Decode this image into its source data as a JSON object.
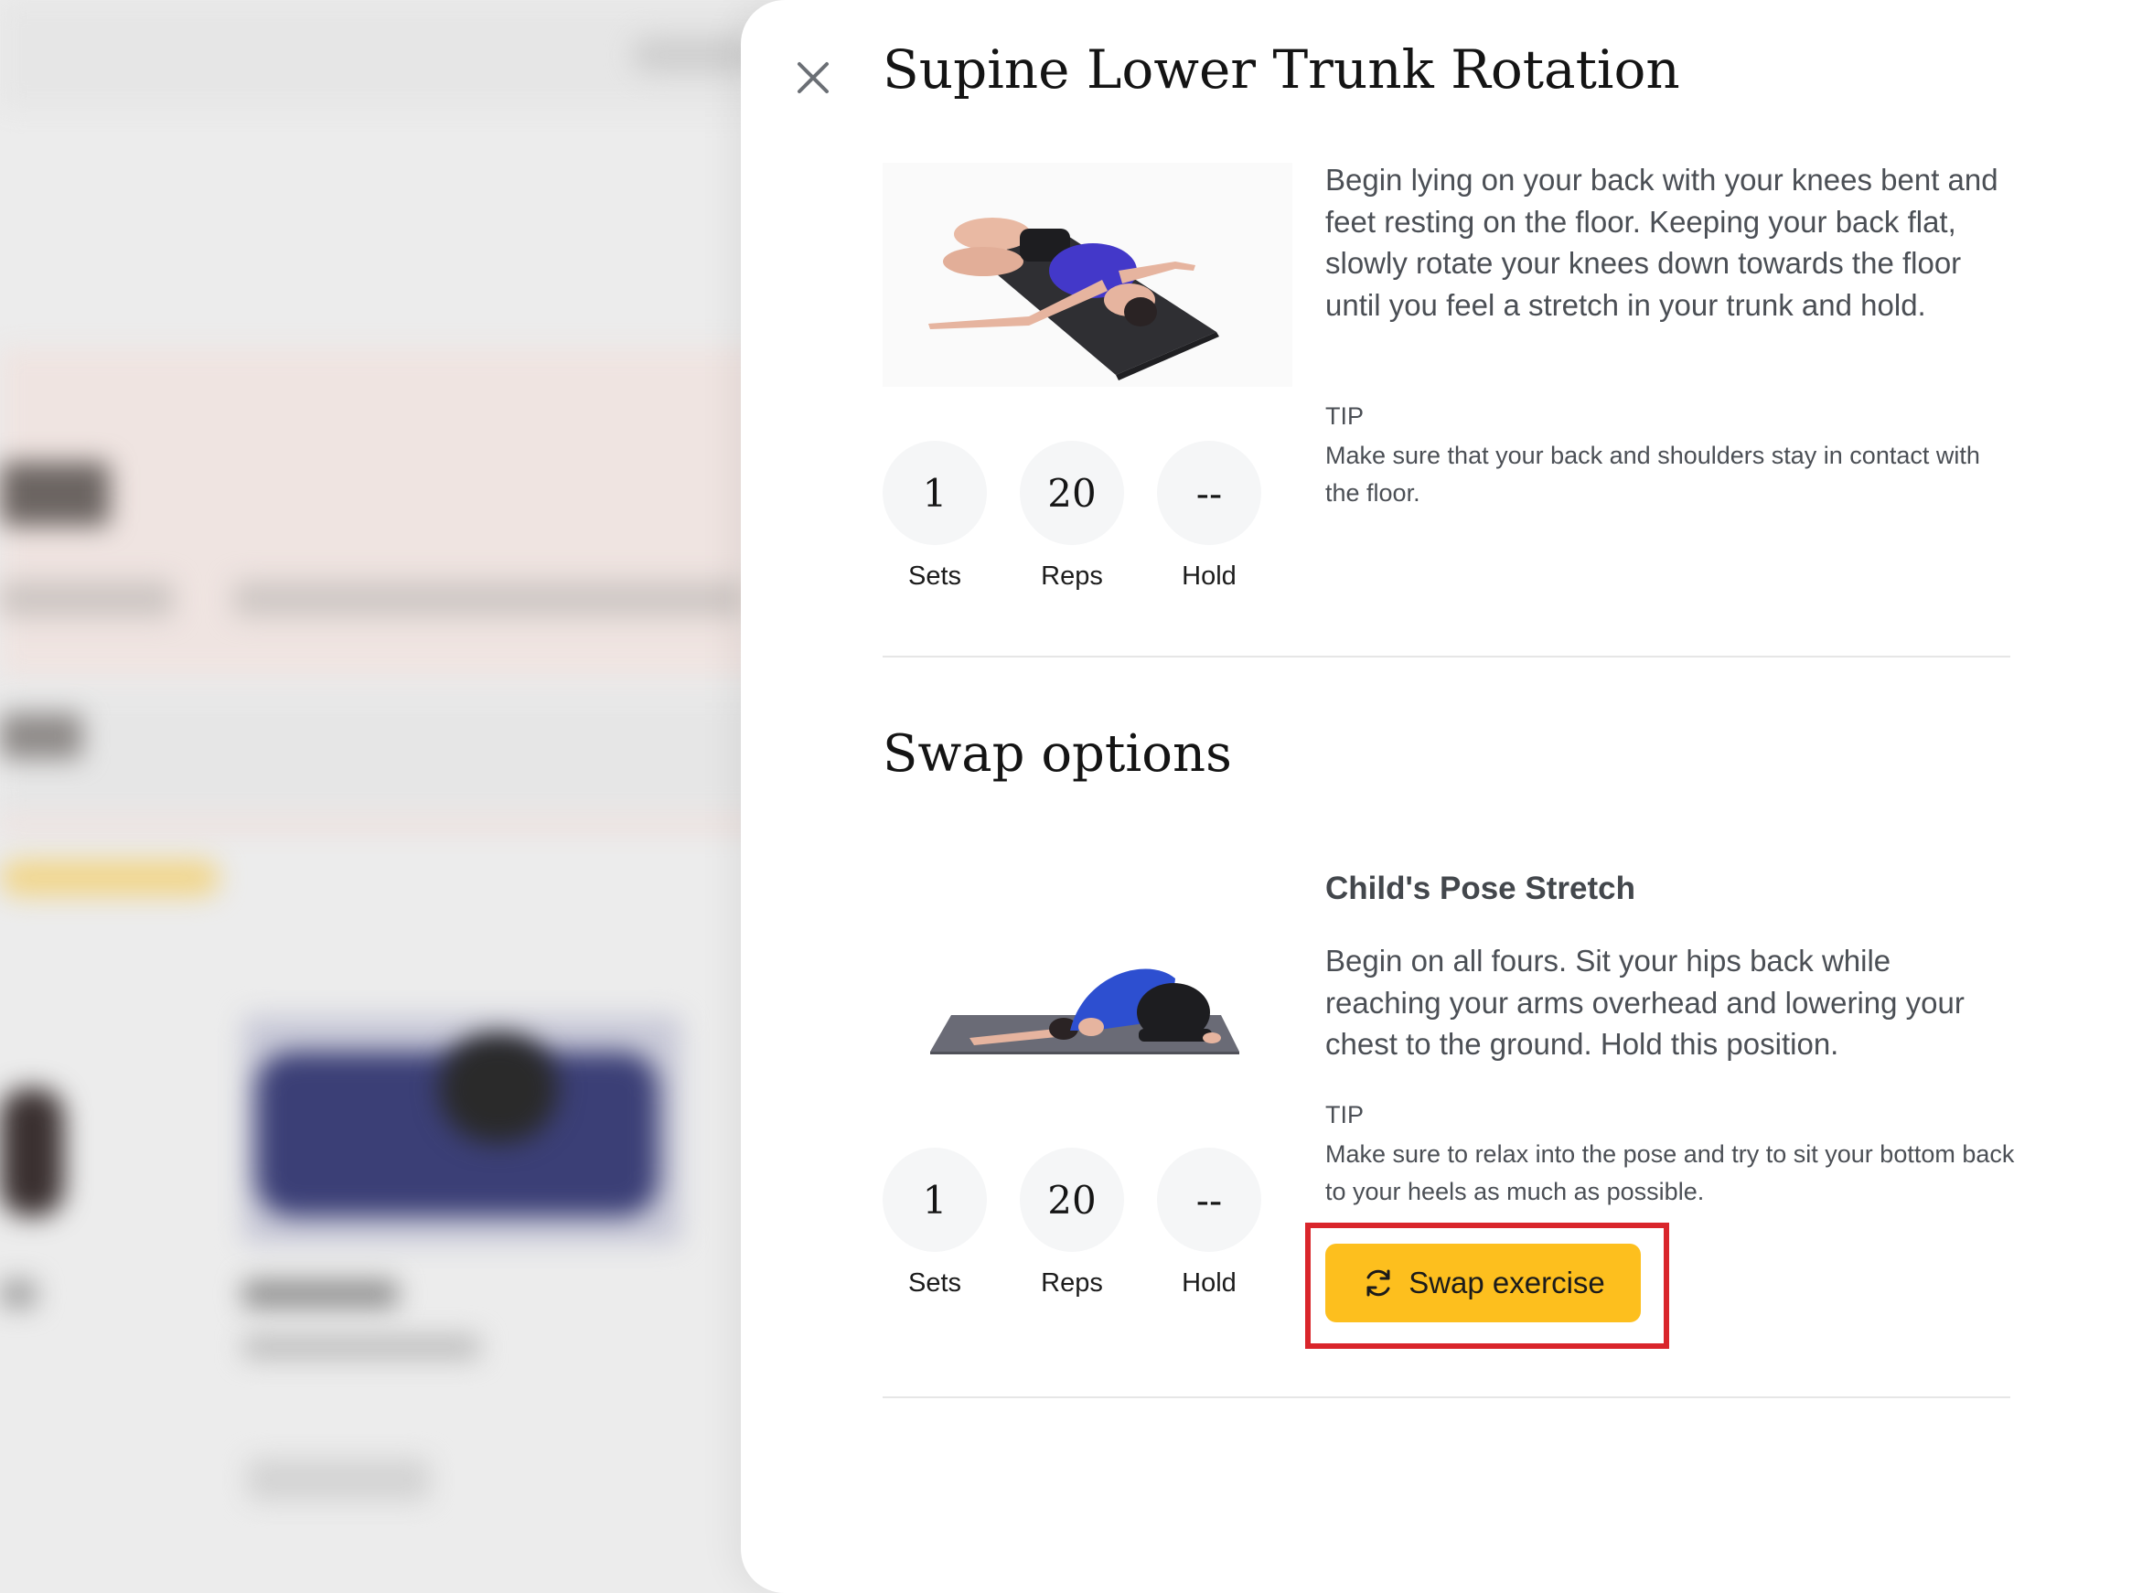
{
  "drawer": {
    "title": "Supine Lower Trunk Rotation",
    "current_exercise": {
      "name": "Supine Lower Trunk Rotation",
      "description": "Begin lying on your back with your knees bent and feet resting on the floor. Keeping your back flat, slowly rotate your knees down towards the floor until you feel a stretch in your trunk and hold.",
      "tip_label": "TIP",
      "tip": "Make sure that your back and shoulders stay in contact with the floor.",
      "stats": [
        {
          "value": "1",
          "label": "Sets"
        },
        {
          "value": "20",
          "label": "Reps"
        },
        {
          "value": "--",
          "label": "Hold"
        }
      ]
    },
    "swap_section": {
      "title": "Swap options",
      "option": {
        "name": "Child's Pose Stretch",
        "description": "Begin on all fours. Sit your hips back while reaching your arms overhead and lowering your chest to the ground. Hold this position.",
        "tip_label": "TIP",
        "tip": "Make sure to relax into the pose and try to sit your bottom back to your heels as much as possible.",
        "stats": [
          {
            "value": "1",
            "label": "Sets"
          },
          {
            "value": "20",
            "label": "Reps"
          },
          {
            "value": "--",
            "label": "Hold"
          }
        ],
        "swap_button_label": "Swap exercise"
      }
    }
  },
  "icons": {
    "close": "close-icon",
    "swap": "refresh-icon"
  },
  "colors": {
    "swap_button": "#fdbf1e",
    "highlight": "#d9252b",
    "mat": "#2f2f33",
    "shirt": "#4338c9"
  }
}
